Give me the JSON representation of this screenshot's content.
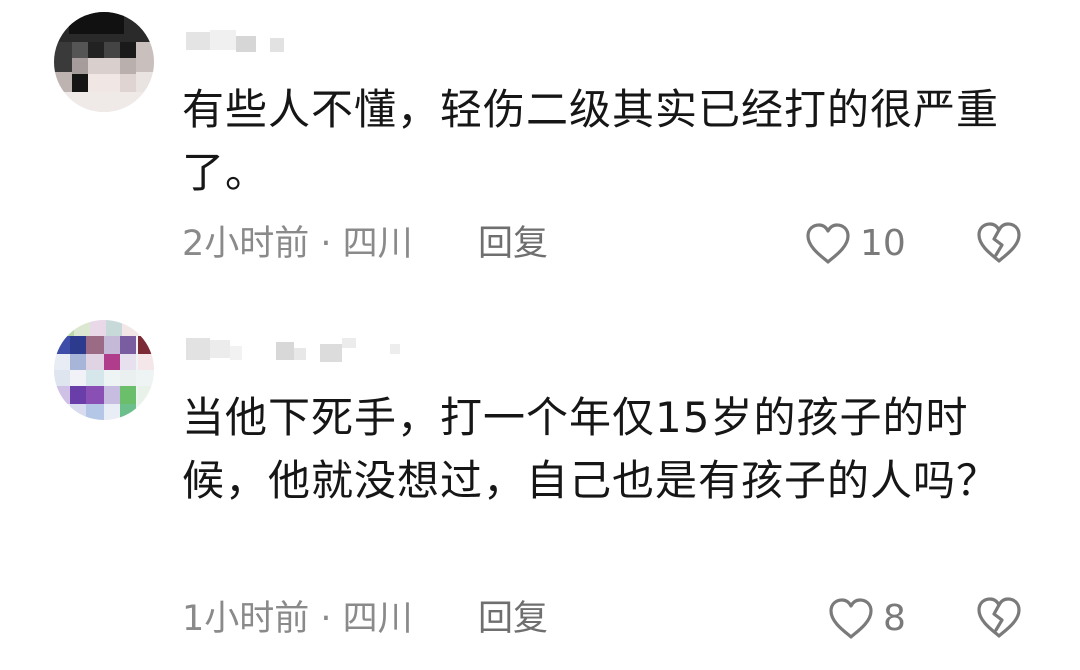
{
  "comments": [
    {
      "text": "有些人不懂，轻伤二级其实已经打的很严重了。",
      "time_location": "2小时前 · 四川",
      "reply_label": "回复",
      "like_count": "10"
    },
    {
      "text": "当他下死手，打一个年仅15岁的孩子的时候，他就没想过，自己也是有孩子的人吗？",
      "time_location": "1小时前 · 四川",
      "reply_label": "回复",
      "like_count": "8"
    }
  ],
  "icons": {
    "like": "heart-outline-icon",
    "dislike": "broken-heart-icon"
  },
  "colors": {
    "text": "#161616",
    "meta": "#8a8a8a",
    "icon": "#7a7a7a"
  }
}
